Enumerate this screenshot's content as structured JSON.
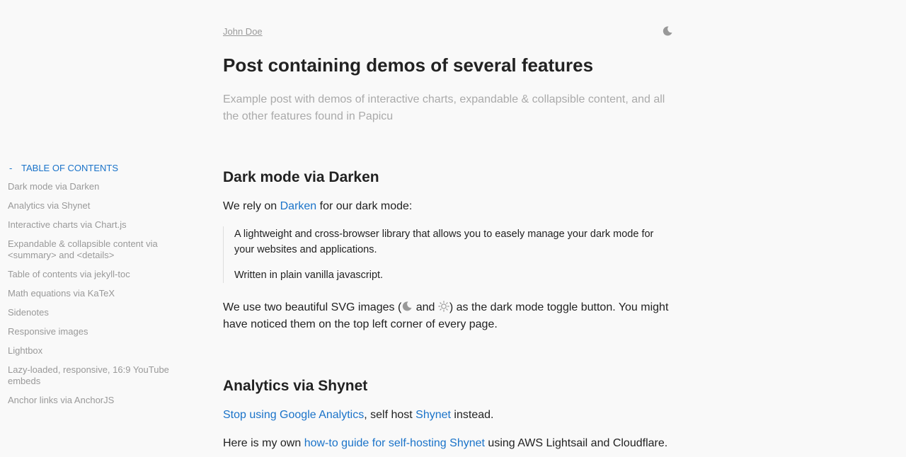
{
  "toc": {
    "toggle": "-",
    "heading": "TABLE OF CONTENTS",
    "items": [
      "Dark mode via Darken",
      "Analytics via Shynet",
      "Interactive charts via Chart.js",
      "Expandable & collapsible content via <summary> and <details>",
      "Table of contents via jekyll-toc",
      "Math equations via KaTeX",
      "Sidenotes",
      "Responsive images",
      "Lightbox",
      "Lazy-loaded, responsive, 16:9 YouTube embeds",
      "Anchor links via AnchorJS"
    ]
  },
  "header": {
    "author": "John Doe",
    "mode_toggle_icon": "moon-icon"
  },
  "post": {
    "title": "Post containing demos of several features",
    "subtitle": "Example post with demos of interactive charts, expandable & collapsible content, and all the other features found in Papicu"
  },
  "section_dark": {
    "heading": "Dark mode via Darken",
    "intro_before": "We rely on ",
    "intro_link": "Darken",
    "intro_after": " for our dark mode:",
    "quote_1": "A lightweight and cross-browser library that allows you to easely manage your dark mode for your websites and applications.",
    "quote_2": "Written in plain vanilla javascript.",
    "svg_before": "We use two beautiful SVG images (",
    "svg_and": " and ",
    "svg_after": ") as the dark mode toggle button. You might have noticed them on the top left corner of every page."
  },
  "section_analytics": {
    "heading": "Analytics via Shynet",
    "link_1": "Stop using Google Analytics",
    "text_1": ", self host ",
    "link_2": "Shynet",
    "text_2": " instead.",
    "text_3": "Here is my own ",
    "link_3": "how-to guide for self-hosting Shynet",
    "text_4": " using AWS Lightsail and Cloudflare."
  },
  "colors": {
    "background": "#f9f9f9",
    "link": "#1a73c9",
    "muted": "#999999"
  }
}
